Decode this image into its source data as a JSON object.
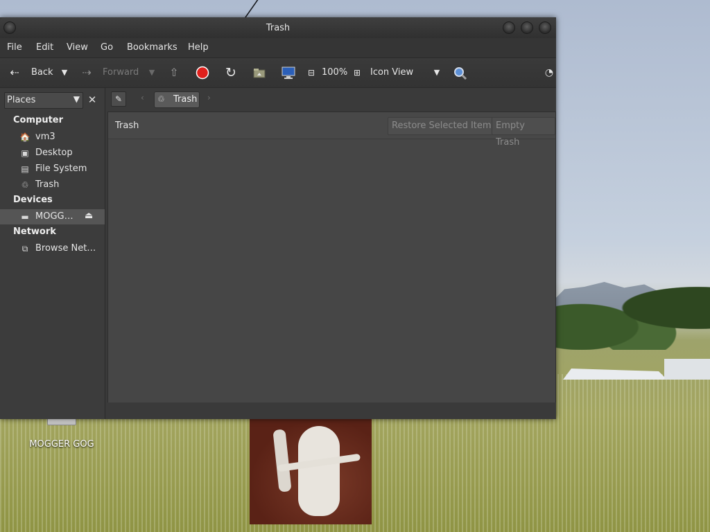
{
  "window": {
    "title": "Trash"
  },
  "menubar": {
    "items": [
      "File",
      "Edit",
      "View",
      "Go",
      "Bookmarks",
      "Help"
    ]
  },
  "toolbar": {
    "back_label": "Back",
    "forward_label": "Forward",
    "zoom_level": "100%",
    "view_mode": "Icon View"
  },
  "sidebar": {
    "selector_label": "Places",
    "sections": {
      "computer": "Computer",
      "devices": "Devices",
      "network": "Network"
    },
    "computer_items": [
      "vm3",
      "Desktop",
      "File System",
      "Trash"
    ],
    "device_items": [
      "MOGG…"
    ],
    "network_items": [
      "Browse Net…"
    ]
  },
  "location": {
    "crumb": "Trash"
  },
  "trash_bar": {
    "label": "Trash",
    "restore_label": "Restore Selected Items",
    "empty_label": "Empty Trash"
  },
  "desktop": {
    "icon_label": "MOGGER GOG"
  },
  "colors": {
    "window_bg": "#3a3a3a",
    "panel_bg": "#464646",
    "stop_red": "#e0201c",
    "selected_bg": "#555555"
  }
}
